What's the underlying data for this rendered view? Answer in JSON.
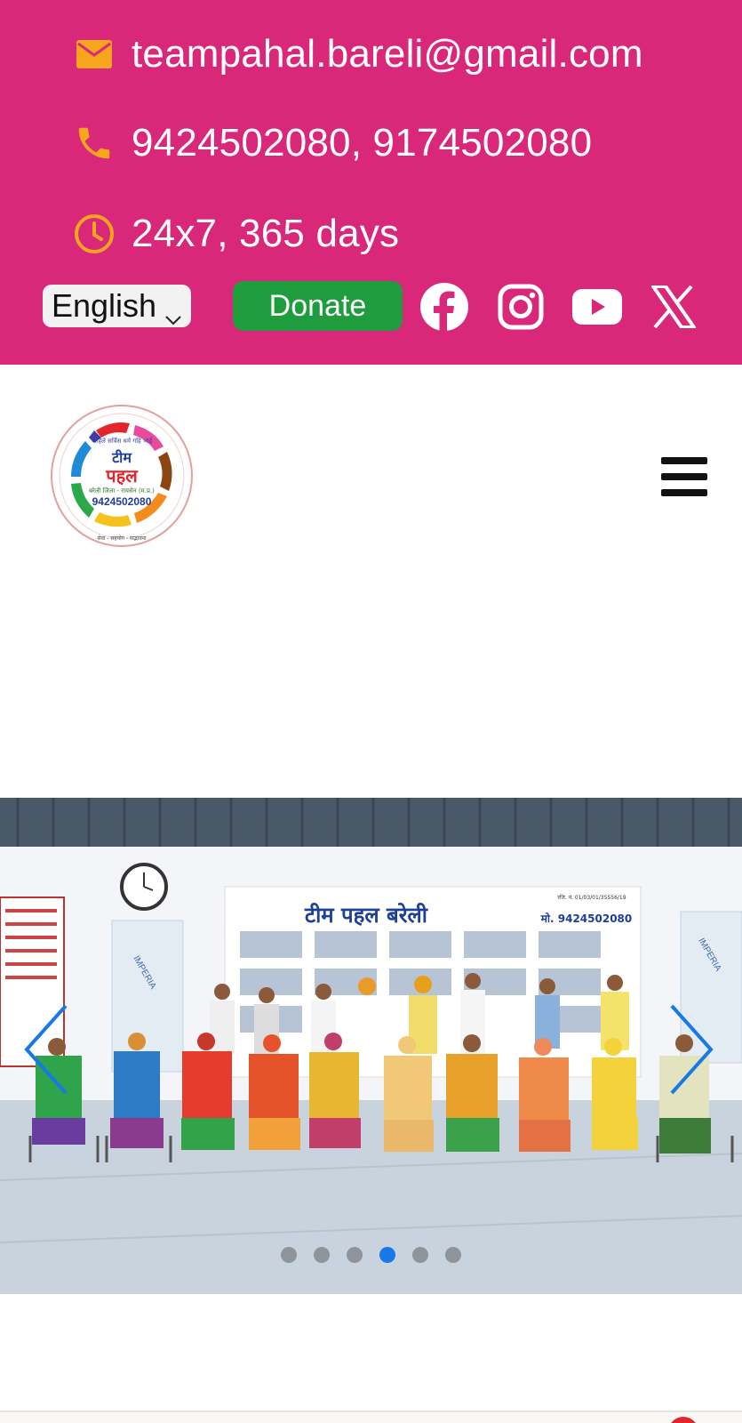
{
  "topbar": {
    "email": "teampahal.bareli@gmail.com",
    "phones": "9424502080, 9174502080",
    "hours": "24x7, 365 days",
    "language_selected": "English",
    "donate_label": "Donate",
    "colors": {
      "background": "#d9287a",
      "icon": "#f7a51d",
      "donate": "#1e9c3e"
    }
  },
  "header": {
    "logo": {
      "top_text": "पाहिले सर्विस धर्म गहि भाई",
      "name": "टीम पहल",
      "place": "बरेली जिला - रायसेन (म.प्र.)",
      "phone": "9424502080",
      "motto": "सेवा - सहयोग - सद्भावना"
    }
  },
  "slider": {
    "banner_title": "टीम पहल बरेली",
    "banner_phone": "मो. 9424502080",
    "banner_reg": "रजि. नं. 01/03/01/35556/19",
    "panel_brand": "IMPERIA",
    "dot_count": 6,
    "active_index": 3
  },
  "icons": {
    "email": "envelope-icon",
    "phone": "phone-icon",
    "hours": "clock-icon",
    "facebook": "facebook-icon",
    "instagram": "instagram-icon",
    "youtube": "youtube-icon",
    "x": "x-twitter-icon",
    "menu": "hamburger-menu-icon"
  }
}
